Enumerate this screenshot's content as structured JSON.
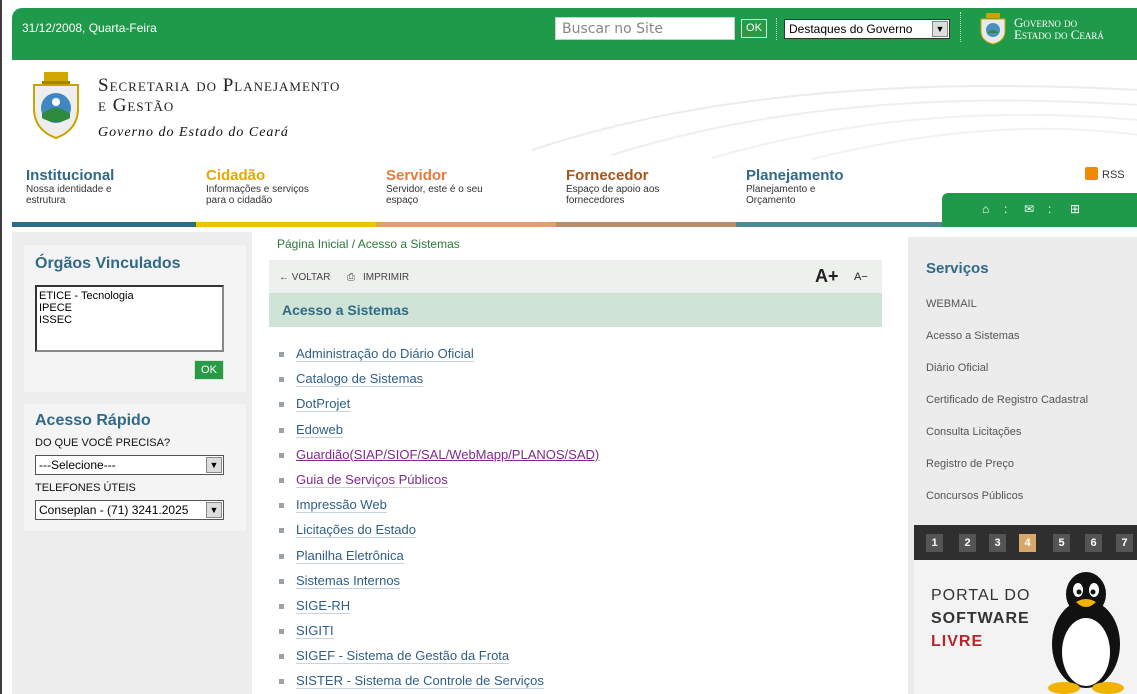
{
  "topbar": {
    "date": "31/12/2008, Quarta-Feira",
    "search_placeholder": "Buscar no Site",
    "search_ok": "OK",
    "gov_select": "Destaques do Governo",
    "gov_line1": "Governo do",
    "gov_line2": "Estado do Ceará",
    "bar_color": "#1f9a4a"
  },
  "header": {
    "title_line1": "Secretaria do Planejamento",
    "title_line2": "e Gestão",
    "subtitle": "Governo do Estado do Ceará"
  },
  "nav": [
    {
      "title": "Institucional",
      "desc1": "Nossa identidade e",
      "desc2": "estrutura",
      "color": "#2f6a87",
      "bar": "#2f6a87"
    },
    {
      "title": "Cidadão",
      "desc1": "Informações e serviços",
      "desc2": "para o cidadão",
      "color": "#e5a800",
      "bar": "#f2c200"
    },
    {
      "title": "Servidor",
      "desc1": "Servidor, este é o seu",
      "desc2": "espaço",
      "color": "#e87a3a",
      "bar": "#e89a70"
    },
    {
      "title": "Fornecedor",
      "desc1": "Espaço de apoio aos",
      "desc2": "fornecedores",
      "color": "#a9541b",
      "bar": "#b78d6a"
    },
    {
      "title": "Planejamento",
      "desc1": "Planejamento e",
      "desc2": "Orçamento",
      "color": "#2f6a87",
      "bar": "#4b8a95"
    }
  ],
  "rss_label": "RSS",
  "quick_icons": [
    "home-icon",
    "mail-icon",
    "sitemap-icon"
  ],
  "orgaos": {
    "title": "Órgãos Vinculados",
    "items": [
      "ETICE - Tecnologia",
      "IPECE",
      "ISSEC"
    ],
    "ok": "OK"
  },
  "acesso_rapido": {
    "title": "Acesso Rápido",
    "label1": "DO QUE VOCÊ PRECISA?",
    "select1": "---Selecione---",
    "label2": "TELEFONES ÚTEIS",
    "select2": "Conseplan - (71) 3241.2025"
  },
  "breadcrumb": "Página Inicial / Acesso a Sistemas",
  "toolbar": {
    "back": "← VOLTAR",
    "print": "IMPRIMIR",
    "font_up": "A+",
    "font_down": "A−"
  },
  "content": {
    "title": "Acesso a Sistemas",
    "systems": [
      "Administração do Diário Oficial",
      "Catalogo de Sistemas",
      "DotProjet",
      "Edoweb",
      "Guardião(SIAP/SIOF/SAL/WebMapp/PLANOS/SAD)",
      "Guia de Serviços Públicos",
      "Impressão Web",
      "Licitações do Estado",
      "Planilha Eletrônica",
      "Sistemas Internos",
      "SIGE-RH",
      "SIGITI",
      "SIGEF - Sistema de Gestão da Frota",
      "SISTER - Sistema de Controle de Serviços"
    ]
  },
  "servicos": {
    "title": "Serviços",
    "items": [
      "WEBMAIL",
      "Acesso a Sistemas",
      "Diário Oficial",
      "Certificado de Registro Cadastral",
      "Consulta Licitações",
      "Registro de Preço",
      "Concursos Públicos"
    ]
  },
  "pager": {
    "pages": [
      "1",
      "2",
      "3",
      "4",
      "5",
      "6",
      "7"
    ],
    "active": "4"
  },
  "banner": {
    "line1": "PORTAL DO",
    "line2": "SOFTWARE",
    "line3": "LIVRE"
  }
}
